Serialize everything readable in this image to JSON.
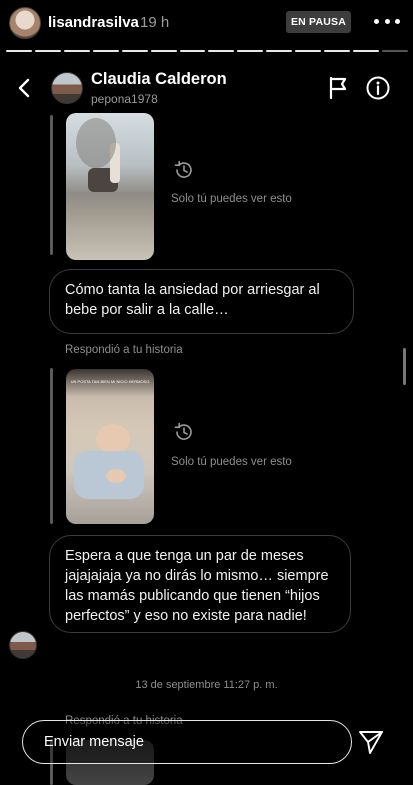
{
  "story": {
    "username": "lisandrasilva",
    "time_ago": "19 h",
    "paused_label": "EN PAUSA",
    "more_icon": "more-horizontal-icon",
    "segments_total": 14,
    "segments_done": 13
  },
  "dm": {
    "header": {
      "back_icon": "chevron-left-icon",
      "name": "Claudia Calderon",
      "handle": "pepona1978",
      "flag_icon": "flag-icon",
      "info_icon": "info-icon"
    },
    "messages": [
      {
        "type": "story_reply",
        "status_text": "Solo tú puedes ver esto",
        "status_icon": "history-icon",
        "thumb_caption": ""
      },
      {
        "type": "text",
        "text": "Cómo tanta la ansiedad por arriesgar al bebe por salir a la calle…"
      },
      {
        "type": "replied_label",
        "text": "Respondió a tu historia"
      },
      {
        "type": "story_reply",
        "status_text": "Solo tú puedes ver esto",
        "status_icon": "history-icon",
        "thumb_caption": "UN POSTA TAN BIEN MI NICIO HERMOSO"
      },
      {
        "type": "text",
        "text": "Espera a que tenga un par de meses jajajajaja ya no dirás lo mismo… siempre las mamás publicando que tienen “hijos perfectos” y eso no existe para nadie!"
      },
      {
        "type": "timestamp",
        "text": "13 de septiembre 11:27 p. m."
      },
      {
        "type": "replied_label",
        "text": "Respondió a tu historia"
      }
    ]
  },
  "reply_bar": {
    "placeholder": "Enviar mensaje",
    "send_icon": "send-icon"
  }
}
